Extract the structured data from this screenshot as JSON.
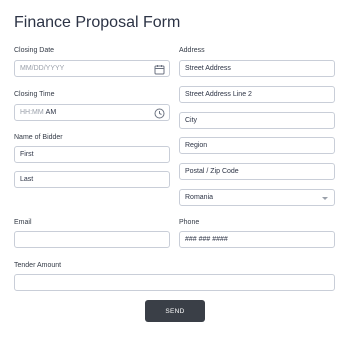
{
  "form": {
    "title": "Finance Proposal Form",
    "closing_date": {
      "label": "Closing Date",
      "placeholder": "MM/DD/YYYY"
    },
    "closing_time": {
      "label": "Closing Time",
      "placeholder_hhmm": "HH:MM",
      "ampm": "AM"
    },
    "name_of_bidder": {
      "label": "Name of Bidder",
      "first": "First",
      "last": "Last"
    },
    "email": {
      "label": "Email",
      "value": ""
    },
    "tender_amount": {
      "label": "Tender Amount",
      "value": ""
    },
    "address": {
      "label": "Address",
      "street1": "Street Address",
      "street2": "Street Address Line 2",
      "city": "City",
      "region": "Region",
      "postal": "Postal / Zip Code",
      "country": "Romania"
    },
    "phone": {
      "label": "Phone",
      "placeholder": "### ### ####"
    },
    "submit_label": "SEND"
  },
  "icons": {
    "calendar": "calendar-icon",
    "clock": "clock-icon",
    "dropdown": "chevron-down-icon"
  },
  "colors": {
    "border": "#c9ced8",
    "button_bg": "#3a3f47",
    "button_text": "#ffffff",
    "title": "#2c3345",
    "placeholder": "#9aa0aa"
  }
}
